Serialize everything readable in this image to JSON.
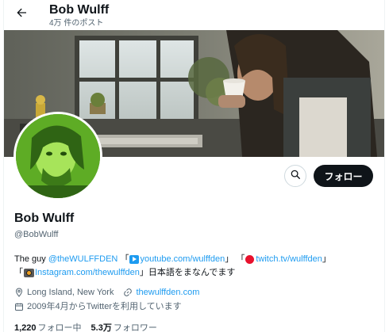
{
  "header": {
    "name": "Bob Wulff",
    "post_count": "4万 件のポスト"
  },
  "icons": {
    "back": "arrow-left-icon",
    "search": "search-icon",
    "location": "location-pin-icon",
    "website": "link-icon",
    "joined": "calendar-icon"
  },
  "actions": {
    "follow_label": "フォロー"
  },
  "profile": {
    "display_name": "Bob Wulff",
    "handle": "@BobWulff",
    "bio": {
      "prefix": "The guy ",
      "mention": "@theWULFFDEN",
      "open1": " 「",
      "youtube": "youtube.com/wulffden",
      "close1": "」 「",
      "twitch": "twitch.tv/wulffden",
      "close2": "」",
      "open3": "「",
      "instagram": "Instagram.com/thewulffden",
      "suffix": "」日本語をまなんでます"
    },
    "location": "Long Island, New York",
    "website": "thewulffden.com",
    "joined": "2009年4月からTwitterを利用しています"
  },
  "stats": {
    "following_count": "1,220",
    "following_label": "フォロー中",
    "followers_count": "5.3万",
    "followers_label": "フォロワー"
  },
  "colors": {
    "accent": "#1d9bf0",
    "text": "#0f1419",
    "muted": "#536471",
    "follow_bg": "#0f1419"
  }
}
